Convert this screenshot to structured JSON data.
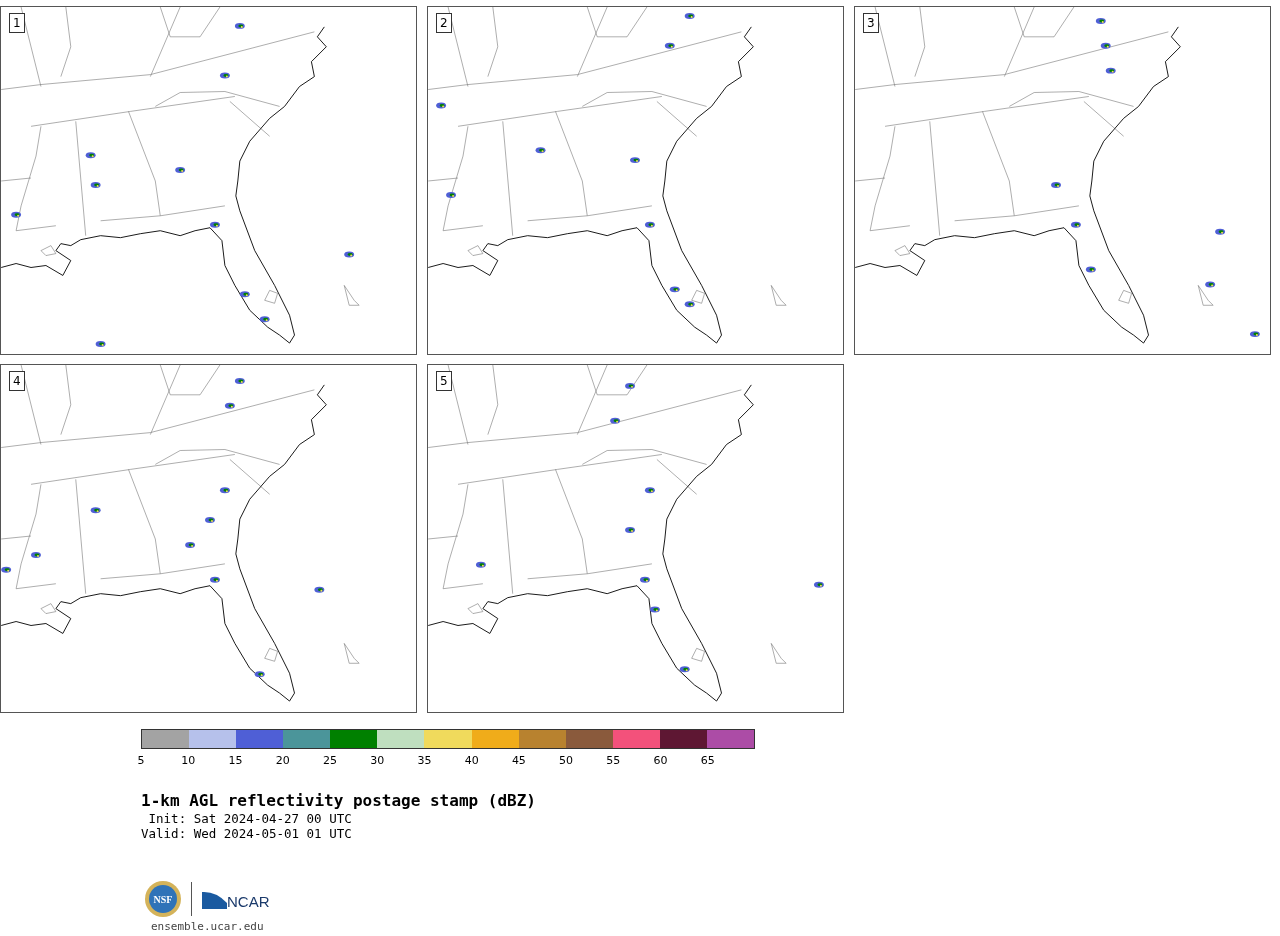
{
  "panels": [
    {
      "label": "1"
    },
    {
      "label": "2"
    },
    {
      "label": "3"
    },
    {
      "label": "4"
    },
    {
      "label": "5"
    }
  ],
  "colorbar": {
    "segments": [
      {
        "color": "#a3a3a3"
      },
      {
        "color": "#b6c1eb"
      },
      {
        "color": "#4f5fd6"
      },
      {
        "color": "#4b959a"
      },
      {
        "color": "#008000"
      },
      {
        "color": "#bfdfbf"
      },
      {
        "color": "#f0da5c"
      },
      {
        "color": "#f0ac1a"
      },
      {
        "color": "#b8822f"
      },
      {
        "color": "#8a5a3c"
      },
      {
        "color": "#f3517b"
      },
      {
        "color": "#5e1733"
      },
      {
        "color": "#ac4ca6"
      }
    ],
    "ticks": [
      "5",
      "10",
      "15",
      "20",
      "25",
      "30",
      "35",
      "40",
      "45",
      "50",
      "55",
      "60",
      "65"
    ]
  },
  "title": "1-km AGL reflectivity postage stamp (dBZ)",
  "init": " Init: Sat 2024-04-27 00 UTC",
  "valid": "Valid: Wed 2024-05-01 01 UTC",
  "logo": {
    "nsf_text": "NSF",
    "ncar_text": "NCAR"
  },
  "footer": "ensemble.ucar.edu"
}
